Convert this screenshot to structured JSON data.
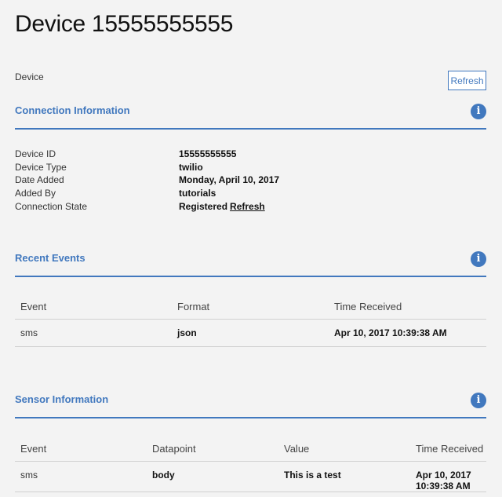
{
  "page": {
    "title": "Device 15555555555",
    "breadcrumb": "Device",
    "refresh_label": "Refresh"
  },
  "connection": {
    "title": "Connection Information",
    "rows": [
      {
        "key": "Device ID",
        "value": "15555555555"
      },
      {
        "key": "Device Type",
        "value": "twilio"
      },
      {
        "key": "Date Added",
        "value": "Monday, April 10, 2017"
      },
      {
        "key": "Added By",
        "value": "tutorials"
      },
      {
        "key": "Connection State",
        "value": "Registered",
        "link": "Refresh"
      }
    ]
  },
  "events": {
    "title": "Recent Events",
    "headers": [
      "Event",
      "Format",
      "Time Received"
    ],
    "rows": [
      [
        "sms",
        "json",
        "Apr 10, 2017 10:39:38 AM"
      ]
    ]
  },
  "sensor": {
    "title": "Sensor Information",
    "headers": [
      "Event",
      "Datapoint",
      "Value",
      "Time Received"
    ],
    "rows": [
      [
        "sms",
        "body",
        "This is a test",
        "Apr 10, 2017",
        "10:39:38 AM"
      ]
    ]
  },
  "icons": {
    "info": "info-icon",
    "accent": "#4178be"
  }
}
